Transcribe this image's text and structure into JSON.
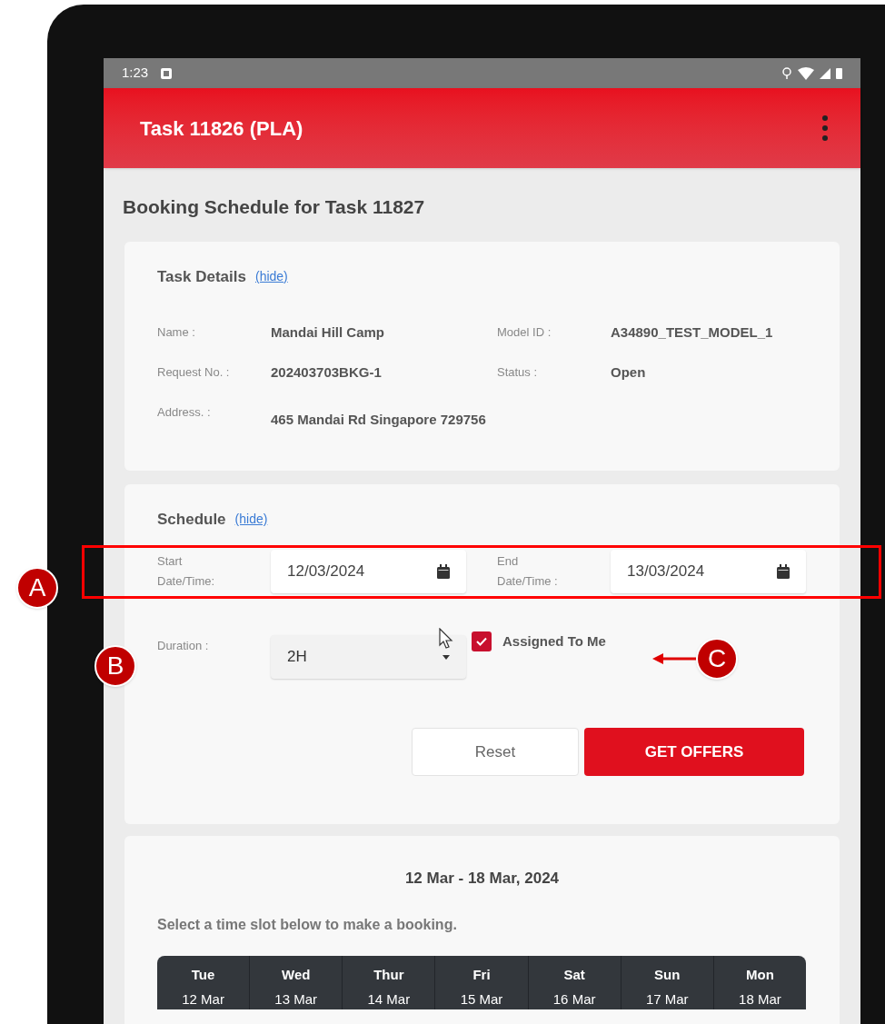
{
  "status_bar": {
    "time": "1:23"
  },
  "app_bar": {
    "title": "Task 11826 (PLA)"
  },
  "page_title": "Booking Schedule for Task 11827",
  "task_details": {
    "title": "Task Details",
    "hide_link": "(hide)",
    "fields": [
      {
        "label": "Name :",
        "value": "Mandai Hill Camp"
      },
      {
        "label": "Model ID :",
        "value": "A34890_TEST_MODEL_1"
      },
      {
        "label": "Request No. :",
        "value": "202403703BKG-1"
      },
      {
        "label": "Status :",
        "value": "Open"
      },
      {
        "label": "Address. :",
        "value": "465 Mandai Rd Singapore 729756"
      }
    ]
  },
  "schedule": {
    "title": "Schedule",
    "hide_link": "(hide)",
    "start": {
      "label": "Start Date/Time:",
      "value": "12/03/2024"
    },
    "end": {
      "label": "End Date/Time :",
      "value": "13/03/2024"
    },
    "duration": {
      "label": "Duration :",
      "value": "2H"
    },
    "assigned": {
      "label": "Assigned To Me",
      "checked": true
    },
    "buttons": [
      {
        "label": "Reset",
        "kind": "secondary"
      },
      {
        "label": "GET OFFERS",
        "kind": "primary"
      }
    ]
  },
  "calendar": {
    "range": "12 Mar - 18 Mar, 2024",
    "instruction": "Select a time slot below to make a booking.",
    "days": [
      {
        "day": "Tue",
        "date": "12 Mar"
      },
      {
        "day": "Wed",
        "date": "13 Mar"
      },
      {
        "day": "Thur",
        "date": "14 Mar"
      },
      {
        "day": "Fri",
        "date": "15 Mar"
      },
      {
        "day": "Sat",
        "date": "16 Mar"
      },
      {
        "day": "Sun",
        "date": "17 Mar"
      },
      {
        "day": "Mon",
        "date": "18 Mar"
      }
    ]
  },
  "annotations": [
    {
      "label": "A"
    },
    {
      "label": "B"
    },
    {
      "label": "C"
    }
  ]
}
